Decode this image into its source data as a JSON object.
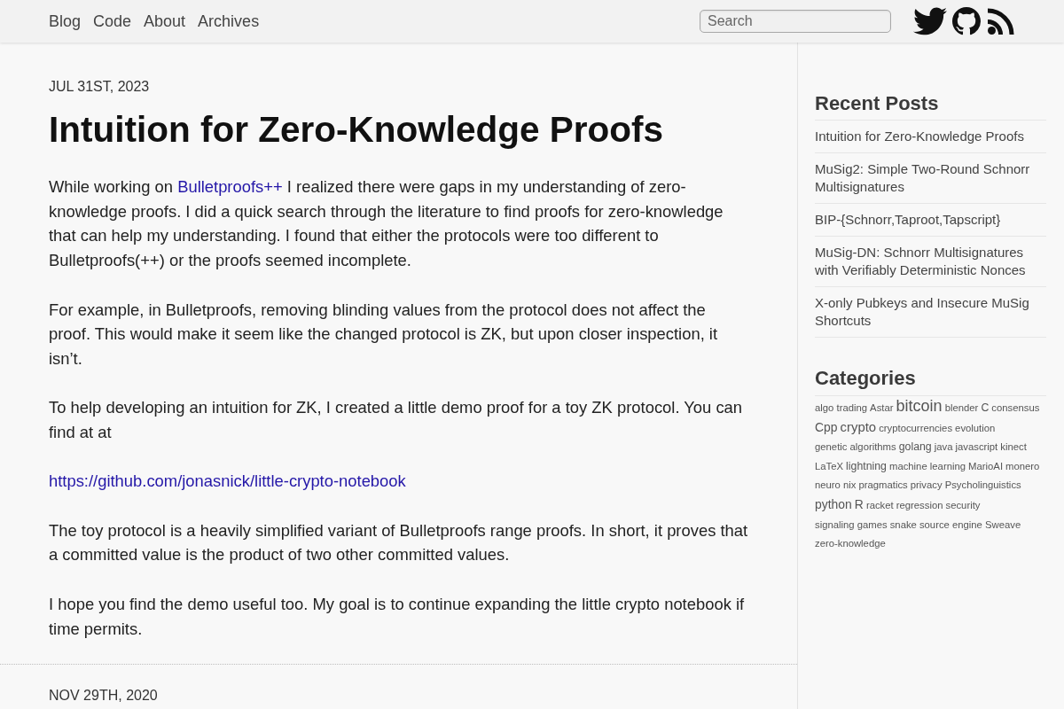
{
  "header": {
    "nav_links": [
      {
        "label": "Blog"
      },
      {
        "label": "Code"
      },
      {
        "label": "About"
      },
      {
        "label": "Archives"
      }
    ],
    "search": {
      "placeholder": "Search"
    }
  },
  "posts": [
    {
      "date": "JUL 31ST, 2023",
      "title": "Intuition for Zero-Knowledge Proofs",
      "paragraphs": [
        {
          "segments": [
            {
              "kind": "text",
              "text": "While working on "
            },
            {
              "kind": "link",
              "text": "Bulletproofs++"
            },
            {
              "kind": "text",
              "text": " I realized there were gaps in my understanding of zero-knowledge proofs. I did a quick search through the literature to find proofs for zero-knowledge that can help my understanding. I found that either the protocols were too different to Bulletproofs(++) or the proofs seemed incomplete."
            }
          ]
        },
        {
          "segments": [
            {
              "kind": "text",
              "text": "For example, in Bulletproofs, removing blinding values from the protocol does not affect the proof. This would make it seem like the changed protocol is ZK, but upon closer inspection, it isn’t."
            }
          ]
        },
        {
          "segments": [
            {
              "kind": "text",
              "text": "To help developing an intuition for ZK, I created a little demo proof for a toy ZK protocol. You can find at at"
            }
          ]
        },
        {
          "segments": [
            {
              "kind": "link",
              "text": "https://github.com/jonasnick/little-crypto-notebook"
            }
          ]
        },
        {
          "segments": [
            {
              "kind": "text",
              "text": "The toy protocol is a heavily simplified variant of Bulletproofs range proofs. In short, it proves that a committed value is the product of two other committed values."
            }
          ]
        },
        {
          "segments": [
            {
              "kind": "text",
              "text": "I hope you find the demo useful too. My goal is to continue expanding the little crypto notebook if time permits."
            }
          ]
        }
      ]
    },
    {
      "date": "NOV 29TH, 2020"
    }
  ],
  "sidebar": {
    "recent_posts": {
      "heading": "Recent Posts",
      "items": [
        "Intuition for Zero-Knowledge Proofs",
        "MuSig2: Simple Two-Round Schnorr Multisignatures",
        "BIP-{Schnorr,Taproot,Tapscript}",
        "MuSig-DN: Schnorr Multisignatures with Verifiably Deterministic Nonces",
        "X-only Pubkeys and Insecure MuSig Shortcuts"
      ]
    },
    "categories": {
      "heading": "Categories",
      "items": [
        {
          "label": "algo trading",
          "kind": "tiny"
        },
        {
          "label": "Astar",
          "kind": "tiny"
        },
        {
          "label": "bitcoin",
          "kind": "huge"
        },
        {
          "label": "blender",
          "kind": "tiny"
        },
        {
          "label": "C",
          "kind": "small"
        },
        {
          "label": "consensus",
          "kind": "tiny"
        },
        {
          "label": "Cpp",
          "kind": "medium"
        },
        {
          "label": "crypto",
          "kind": "large"
        },
        {
          "label": "cryptocurrencies",
          "kind": "tiny"
        },
        {
          "label": "evolution",
          "kind": "tiny"
        },
        {
          "label": "genetic algorithms",
          "kind": "tiny"
        },
        {
          "label": "golang",
          "kind": "small"
        },
        {
          "label": "java",
          "kind": "tiny"
        },
        {
          "label": "javascript",
          "kind": "tiny"
        },
        {
          "label": "kinect",
          "kind": "tiny"
        },
        {
          "label": "LaTeX",
          "kind": "tiny"
        },
        {
          "label": "lightning",
          "kind": "small"
        },
        {
          "label": "machine learning",
          "kind": "tiny"
        },
        {
          "label": "MarioAI",
          "kind": "tiny"
        },
        {
          "label": "monero",
          "kind": "tiny"
        },
        {
          "label": "neuro",
          "kind": "tiny"
        },
        {
          "label": "nix",
          "kind": "tiny"
        },
        {
          "label": "pragmatics",
          "kind": "tiny"
        },
        {
          "label": "privacy",
          "kind": "tiny"
        },
        {
          "label": "Psycholinguistics",
          "kind": "tiny"
        },
        {
          "label": "python",
          "kind": "medium"
        },
        {
          "label": "R",
          "kind": "medium"
        },
        {
          "label": "racket",
          "kind": "tiny"
        },
        {
          "label": "regression",
          "kind": "tiny"
        },
        {
          "label": "security",
          "kind": "tiny"
        },
        {
          "label": "signaling games",
          "kind": "tiny"
        },
        {
          "label": "snake",
          "kind": "tiny"
        },
        {
          "label": "source engine",
          "kind": "tiny"
        },
        {
          "label": "Sweave",
          "kind": "tiny"
        },
        {
          "label": "zero-knowledge",
          "kind": "tiny"
        }
      ]
    }
  }
}
